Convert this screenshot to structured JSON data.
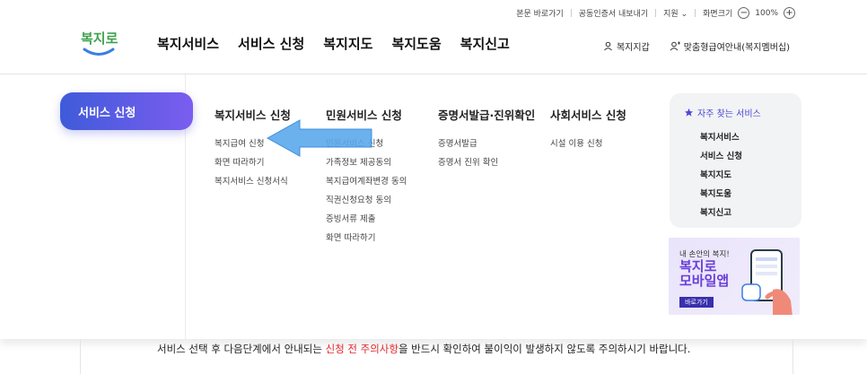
{
  "util": {
    "skip": "본문 바로가기",
    "cert": "공동인증서 내보내기",
    "support": "지원",
    "zoom_label": "화면크기",
    "zoom_minus": "−",
    "zoom_value": "100%",
    "zoom_plus": "+"
  },
  "logo": {
    "text": "복지로"
  },
  "gnb": [
    "복지서비스",
    "서비스 신청",
    "복지지도",
    "복지도움",
    "복지신고"
  ],
  "header_right": {
    "wallet": "복지지갑",
    "membership": "맞춤형급여안내(복지멤버십)"
  },
  "side": {
    "active": "서비스 신청"
  },
  "columns": [
    {
      "title": "복지서비스 신청",
      "items": [
        "복지급여 신청",
        "화면 따라하기",
        "복지서비스 신청서식"
      ]
    },
    {
      "title": "민원서비스 신청",
      "items": [
        "민원서비스 신청",
        "가족정보 제공동의",
        "복지급여계좌변경 동의",
        "직권신청요청 동의",
        "증빙서류 제출",
        "화면 따라하기"
      ]
    },
    {
      "title": "증명서발급·진위확인",
      "items": [
        "증명서발급",
        "증명서 진위 확인"
      ]
    },
    {
      "title": "사회서비스 신청",
      "items": [
        "시설 이용 신청"
      ]
    }
  ],
  "favorites": {
    "title": "자주 찾는 서비스",
    "items": [
      "복지서비스",
      "서비스 신청",
      "복지지도",
      "복지도움",
      "복지신고"
    ]
  },
  "banner": {
    "line1": "내 손안의 복지!",
    "line2": "복지로",
    "line3": "모바일앱",
    "button": "바로가기"
  },
  "notice": {
    "part1": "서비스 선택 후 다음단계에서 안내되는 ",
    "highlight": "신청 전 주의사항",
    "part2": "을 반드시 확인하여 불이익이 발생하지 않도록 주의하시기 바랍니다."
  },
  "colors": {
    "accent": "#4a48d6",
    "gradient_start": "#3f5bd9",
    "gradient_end": "#7b5df0",
    "arrow": "#5aa8ec",
    "highlight": "#e0262b"
  }
}
